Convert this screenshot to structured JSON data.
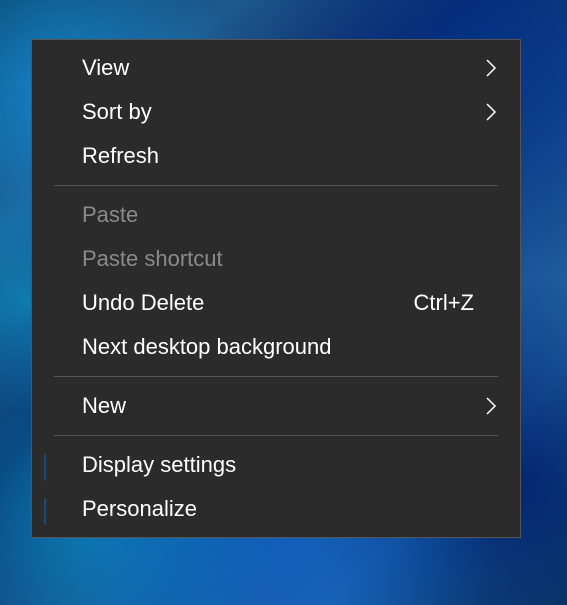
{
  "contextMenu": {
    "items": {
      "view": {
        "label": "View",
        "hasSubmenu": true
      },
      "sortBy": {
        "label": "Sort by",
        "hasSubmenu": true
      },
      "refresh": {
        "label": "Refresh"
      },
      "paste": {
        "label": "Paste",
        "disabled": true
      },
      "pasteShortcut": {
        "label": "Paste shortcut",
        "disabled": true
      },
      "undoDelete": {
        "label": "Undo Delete",
        "shortcut": "Ctrl+Z"
      },
      "nextBackground": {
        "label": "Next desktop background"
      },
      "new": {
        "label": "New",
        "hasSubmenu": true
      },
      "displaySettings": {
        "label": "Display settings",
        "icon": "monitor"
      },
      "personalize": {
        "label": "Personalize",
        "icon": "monitor-color"
      }
    }
  }
}
